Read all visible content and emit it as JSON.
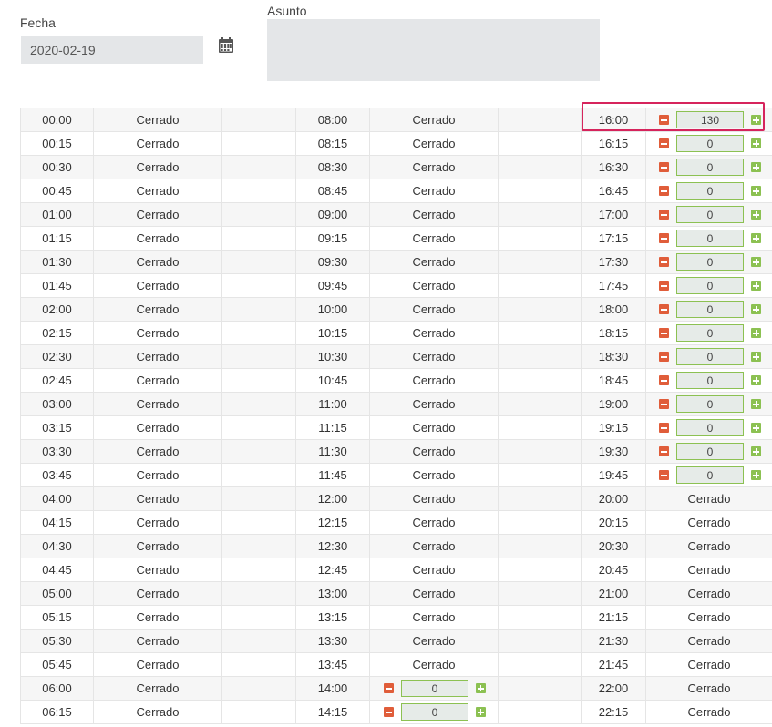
{
  "header": {
    "fecha_label": "Fecha",
    "fecha_value": "2020-02-19",
    "asunto_label": "Asunto",
    "asunto_value": ""
  },
  "colors": {
    "minus": "#e05d3a",
    "plus": "#8cc152",
    "highlight": "#d6245c"
  },
  "rows": [
    {
      "t1": "00:00",
      "s1": "Cerrado",
      "t2": "08:00",
      "s2": "Cerrado",
      "t3": "16:00",
      "q3": "130"
    },
    {
      "t1": "00:15",
      "s1": "Cerrado",
      "t2": "08:15",
      "s2": "Cerrado",
      "t3": "16:15",
      "q3": "0"
    },
    {
      "t1": "00:30",
      "s1": "Cerrado",
      "t2": "08:30",
      "s2": "Cerrado",
      "t3": "16:30",
      "q3": "0"
    },
    {
      "t1": "00:45",
      "s1": "Cerrado",
      "t2": "08:45",
      "s2": "Cerrado",
      "t3": "16:45",
      "q3": "0"
    },
    {
      "t1": "01:00",
      "s1": "Cerrado",
      "t2": "09:00",
      "s2": "Cerrado",
      "t3": "17:00",
      "q3": "0"
    },
    {
      "t1": "01:15",
      "s1": "Cerrado",
      "t2": "09:15",
      "s2": "Cerrado",
      "t3": "17:15",
      "q3": "0"
    },
    {
      "t1": "01:30",
      "s1": "Cerrado",
      "t2": "09:30",
      "s2": "Cerrado",
      "t3": "17:30",
      "q3": "0"
    },
    {
      "t1": "01:45",
      "s1": "Cerrado",
      "t2": "09:45",
      "s2": "Cerrado",
      "t3": "17:45",
      "q3": "0"
    },
    {
      "t1": "02:00",
      "s1": "Cerrado",
      "t2": "10:00",
      "s2": "Cerrado",
      "t3": "18:00",
      "q3": "0"
    },
    {
      "t1": "02:15",
      "s1": "Cerrado",
      "t2": "10:15",
      "s2": "Cerrado",
      "t3": "18:15",
      "q3": "0"
    },
    {
      "t1": "02:30",
      "s1": "Cerrado",
      "t2": "10:30",
      "s2": "Cerrado",
      "t3": "18:30",
      "q3": "0"
    },
    {
      "t1": "02:45",
      "s1": "Cerrado",
      "t2": "10:45",
      "s2": "Cerrado",
      "t3": "18:45",
      "q3": "0"
    },
    {
      "t1": "03:00",
      "s1": "Cerrado",
      "t2": "11:00",
      "s2": "Cerrado",
      "t3": "19:00",
      "q3": "0"
    },
    {
      "t1": "03:15",
      "s1": "Cerrado",
      "t2": "11:15",
      "s2": "Cerrado",
      "t3": "19:15",
      "q3": "0"
    },
    {
      "t1": "03:30",
      "s1": "Cerrado",
      "t2": "11:30",
      "s2": "Cerrado",
      "t3": "19:30",
      "q3": "0"
    },
    {
      "t1": "03:45",
      "s1": "Cerrado",
      "t2": "11:45",
      "s2": "Cerrado",
      "t3": "19:45",
      "q3": "0"
    },
    {
      "t1": "04:00",
      "s1": "Cerrado",
      "t2": "12:00",
      "s2": "Cerrado",
      "t3": "20:00",
      "s3": "Cerrado"
    },
    {
      "t1": "04:15",
      "s1": "Cerrado",
      "t2": "12:15",
      "s2": "Cerrado",
      "t3": "20:15",
      "s3": "Cerrado"
    },
    {
      "t1": "04:30",
      "s1": "Cerrado",
      "t2": "12:30",
      "s2": "Cerrado",
      "t3": "20:30",
      "s3": "Cerrado"
    },
    {
      "t1": "04:45",
      "s1": "Cerrado",
      "t2": "12:45",
      "s2": "Cerrado",
      "t3": "20:45",
      "s3": "Cerrado"
    },
    {
      "t1": "05:00",
      "s1": "Cerrado",
      "t2": "13:00",
      "s2": "Cerrado",
      "t3": "21:00",
      "s3": "Cerrado"
    },
    {
      "t1": "05:15",
      "s1": "Cerrado",
      "t2": "13:15",
      "s2": "Cerrado",
      "t3": "21:15",
      "s3": "Cerrado"
    },
    {
      "t1": "05:30",
      "s1": "Cerrado",
      "t2": "13:30",
      "s2": "Cerrado",
      "t3": "21:30",
      "s3": "Cerrado"
    },
    {
      "t1": "05:45",
      "s1": "Cerrado",
      "t2": "13:45",
      "s2": "Cerrado",
      "t3": "21:45",
      "s3": "Cerrado"
    },
    {
      "t1": "06:00",
      "s1": "Cerrado",
      "t2": "14:00",
      "q2": "0",
      "t3": "22:00",
      "s3": "Cerrado"
    },
    {
      "t1": "06:15",
      "s1": "Cerrado",
      "t2": "14:15",
      "q2": "0",
      "t3": "22:15",
      "s3": "Cerrado"
    }
  ]
}
